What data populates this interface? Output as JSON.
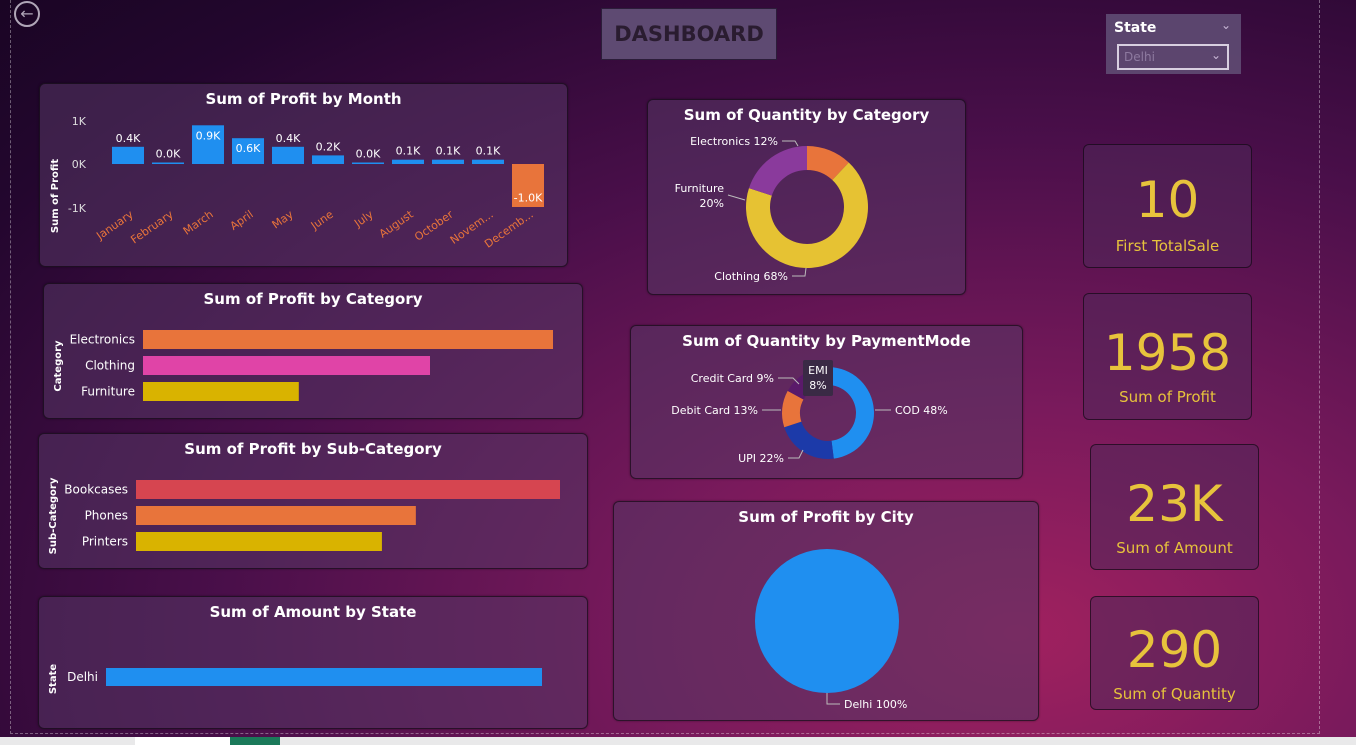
{
  "header": {
    "title": "DASHBOARD",
    "back_icon": "back-arrow-icon"
  },
  "slicer": {
    "title": "State",
    "value": "Delhi"
  },
  "kpis": [
    {
      "value": "10",
      "label": "First TotalSale"
    },
    {
      "value": "1958",
      "label": "Sum of Profit"
    },
    {
      "value": "23K",
      "label": "Sum of Amount"
    },
    {
      "value": "290",
      "label": "Sum of Quantity"
    }
  ],
  "charts": {
    "profit_by_month": {
      "title": "Sum of Profit by Month",
      "ylabel": "Sum of Profit",
      "yticks": [
        "1K",
        "0K",
        "-1K"
      ]
    },
    "profit_by_category": {
      "title": "Sum of Profit by Category",
      "ylabel": "Category"
    },
    "profit_by_subcategory": {
      "title": "Sum of Profit by Sub-Category",
      "ylabel": "Sub-Category"
    },
    "amount_by_state": {
      "title": "Sum of Amount by State",
      "ylabel": "State"
    },
    "quantity_by_category": {
      "title": "Sum of Quantity by Category"
    },
    "quantity_by_paymentmode": {
      "title": "Sum of Quantity by PaymentMode"
    },
    "profit_by_city": {
      "title": "Sum of Profit by City"
    }
  },
  "chart_data": [
    {
      "id": "profit_by_month",
      "type": "bar",
      "title": "Sum of Profit by Month",
      "ylabel": "Sum of Profit",
      "categories": [
        "January",
        "February",
        "March",
        "April",
        "May",
        "June",
        "July",
        "August",
        "October",
        "Novem...",
        "Decemb..."
      ],
      "values": [
        400,
        20,
        900,
        600,
        400,
        200,
        10,
        100,
        100,
        100,
        -1000
      ],
      "labels": [
        "0.4K",
        "0.0K",
        "0.9K",
        "0.6K",
        "0.4K",
        "0.2K",
        "0.0K",
        "0.1K",
        "0.1K",
        "0.1K",
        "-1.0K"
      ],
      "ylim": [
        -1000,
        1000
      ],
      "colors": {
        "positive": "#1f8ff0",
        "negative": "#e8743b"
      }
    },
    {
      "id": "profit_by_category",
      "type": "bar",
      "orientation": "horizontal",
      "title": "Sum of Profit by Category",
      "ylabel": "Category",
      "categories": [
        "Electronics",
        "Clothing",
        "Furniture"
      ],
      "values": [
        1000,
        700,
        380
      ],
      "colors": [
        "#e8743b",
        "#e044a7",
        "#d9b300"
      ]
    },
    {
      "id": "profit_by_subcategory",
      "type": "bar",
      "orientation": "horizontal",
      "title": "Sum of Profit by Sub-Category",
      "ylabel": "Sub-Category",
      "categories": [
        "Bookcases",
        "Phones",
        "Printers"
      ],
      "values": [
        1000,
        660,
        580
      ],
      "colors": [
        "#d64550",
        "#e8743b",
        "#d9b300"
      ]
    },
    {
      "id": "amount_by_state",
      "type": "bar",
      "orientation": "horizontal",
      "title": "Sum of Amount by State",
      "ylabel": "State",
      "categories": [
        "Delhi"
      ],
      "values": [
        23000
      ],
      "colors": [
        "#1f8ff0"
      ]
    },
    {
      "id": "quantity_by_category",
      "type": "pie",
      "donut": true,
      "title": "Sum of Quantity by Category",
      "slices": [
        {
          "name": "Clothing",
          "value": 68,
          "label": "Clothing 68%",
          "color": "#e6c233"
        },
        {
          "name": "Furniture",
          "value": 20,
          "label": "Furniture 20%",
          "color": "#8a3a9c"
        },
        {
          "name": "Electronics",
          "value": 12,
          "label": "Electronics 12%",
          "color": "#e8743b"
        }
      ]
    },
    {
      "id": "quantity_by_paymentmode",
      "type": "pie",
      "donut": true,
      "title": "Sum of Quantity by PaymentMode",
      "slices": [
        {
          "name": "COD",
          "value": 48,
          "label": "COD 48%",
          "color": "#1f8ff0"
        },
        {
          "name": "UPI",
          "value": 22,
          "label": "UPI 22%",
          "color": "#1c3aa9"
        },
        {
          "name": "Debit Card",
          "value": 13,
          "label": "Debit Card 13%",
          "color": "#e8743b"
        },
        {
          "name": "Credit Card",
          "value": 9,
          "label": "Credit Card 9%",
          "color": "#5a1a6a"
        },
        {
          "name": "EMI",
          "value": 8,
          "label": "EMI 8%",
          "color": "#7b2a8c"
        }
      ],
      "tooltip": {
        "name": "EMI",
        "value": "8%"
      }
    },
    {
      "id": "profit_by_city",
      "type": "pie",
      "title": "Sum of Profit by City",
      "slices": [
        {
          "name": "Delhi",
          "value": 100,
          "label": "Delhi 100%",
          "color": "#1f8ff0"
        }
      ]
    }
  ]
}
